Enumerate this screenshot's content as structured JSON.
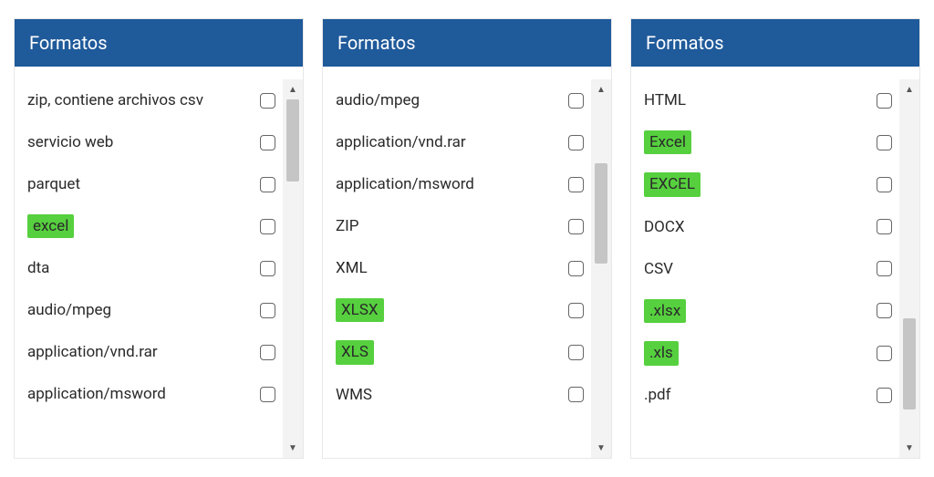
{
  "panels": [
    {
      "title": "Formatos",
      "items": [
        {
          "label": "zip, contiene archivos csv",
          "highlighted": false
        },
        {
          "label": "servicio web",
          "highlighted": false
        },
        {
          "label": "parquet",
          "highlighted": false
        },
        {
          "label": "excel",
          "highlighted": true
        },
        {
          "label": "dta",
          "highlighted": false
        },
        {
          "label": "audio/mpeg",
          "highlighted": false
        },
        {
          "label": "application/vnd.rar",
          "highlighted": false
        },
        {
          "label": "application/msword",
          "highlighted": false
        }
      ],
      "scroll": {
        "thumbTop": 0,
        "thumbHeight": 90
      }
    },
    {
      "title": "Formatos",
      "items": [
        {
          "label": "audio/mpeg",
          "highlighted": false
        },
        {
          "label": "application/vnd.rar",
          "highlighted": false
        },
        {
          "label": "application/msword",
          "highlighted": false
        },
        {
          "label": "ZIP",
          "highlighted": false
        },
        {
          "label": "XML",
          "highlighted": false
        },
        {
          "label": "XLSX",
          "highlighted": true
        },
        {
          "label": "XLS",
          "highlighted": true
        },
        {
          "label": "WMS",
          "highlighted": false
        }
      ],
      "scroll": {
        "thumbTop": 70,
        "thumbHeight": 110
      }
    },
    {
      "title": "Formatos",
      "items": [
        {
          "label": "HTML",
          "highlighted": false
        },
        {
          "label": "Excel",
          "highlighted": true
        },
        {
          "label": "EXCEL",
          "highlighted": true
        },
        {
          "label": "DOCX",
          "highlighted": false
        },
        {
          "label": "CSV",
          "highlighted": false
        },
        {
          "label": ".xlsx",
          "highlighted": true
        },
        {
          "label": ".xls",
          "highlighted": true
        },
        {
          "label": ".pdf",
          "highlighted": false
        }
      ],
      "scroll": {
        "thumbTop": 240,
        "thumbHeight": 100
      }
    }
  ]
}
